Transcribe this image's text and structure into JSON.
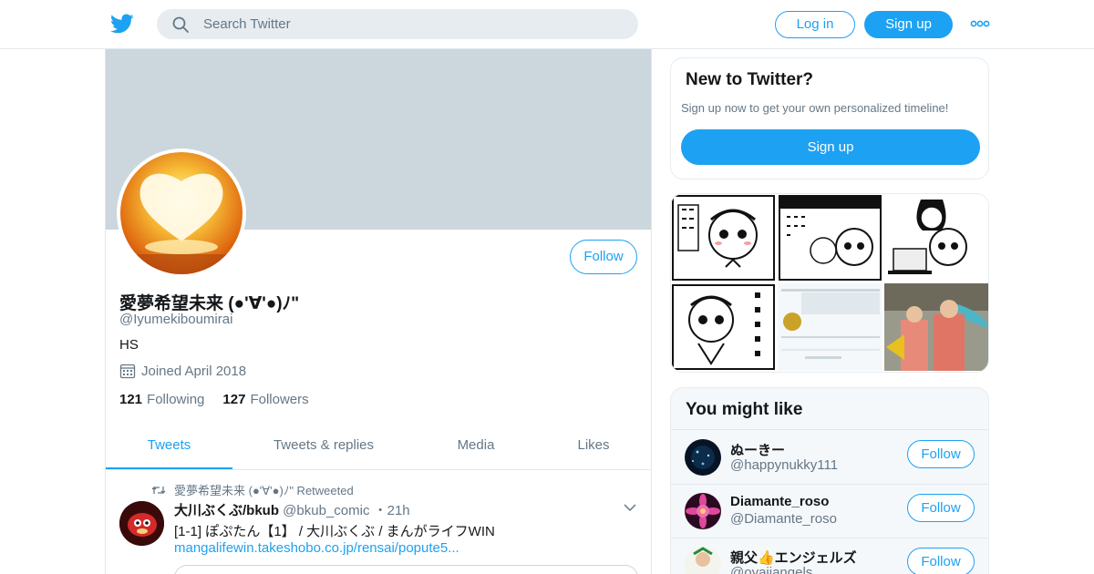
{
  "topbar": {
    "logo_icon": "twitter-bird-icon",
    "search_placeholder": "Search Twitter",
    "login_label": "Log in",
    "signup_label": "Sign up",
    "more_icon": "more-dots-icon"
  },
  "profile": {
    "follow_label": "Follow",
    "name": "愛夢希望未来 (●'∀'●)ﾉ\"",
    "handle": "@Iyumekiboumirai",
    "bio": "HS",
    "joined": "Joined April 2018",
    "following_count": "121",
    "following_label": "Following",
    "followers_count": "127",
    "followers_label": "Followers"
  },
  "tabs": [
    {
      "label": "Tweets",
      "active": true
    },
    {
      "label": "Tweets & replies",
      "active": false
    },
    {
      "label": "Media",
      "active": false
    },
    {
      "label": "Likes",
      "active": false
    }
  ],
  "tweet": {
    "retweet_line": "愛夢希望未来 (●'∀'●)ﾉ\" Retweeted",
    "author_name": "大川ぶくぶ/bkub",
    "author_handle": "@bkub_comic",
    "time": "・21h",
    "text": "[1-1] ぽぷたん【1】 / 大川ぶくぶ / まんがライフWIN",
    "link": "mangalifewin.takeshobo.co.jp/rensai/popute5..."
  },
  "new_to_twitter": {
    "title": "New to Twitter?",
    "desc": "Sign up now to get your own personalized timeline!",
    "button": "Sign up"
  },
  "you_might_like": {
    "title": "You might like",
    "users": [
      {
        "name": "ぬーきー",
        "handle": "@happynukky111",
        "follow": "Follow"
      },
      {
        "name": "Diamante_roso",
        "handle": "@Diamante_roso",
        "follow": "Follow"
      },
      {
        "name": "親父👍エンジェルズ",
        "handle": "@oyajiangels",
        "follow": "Follow"
      }
    ]
  },
  "colors": {
    "accent": "#1da1f2",
    "banner": "#ccd6dd",
    "muted_text": "#657786"
  }
}
